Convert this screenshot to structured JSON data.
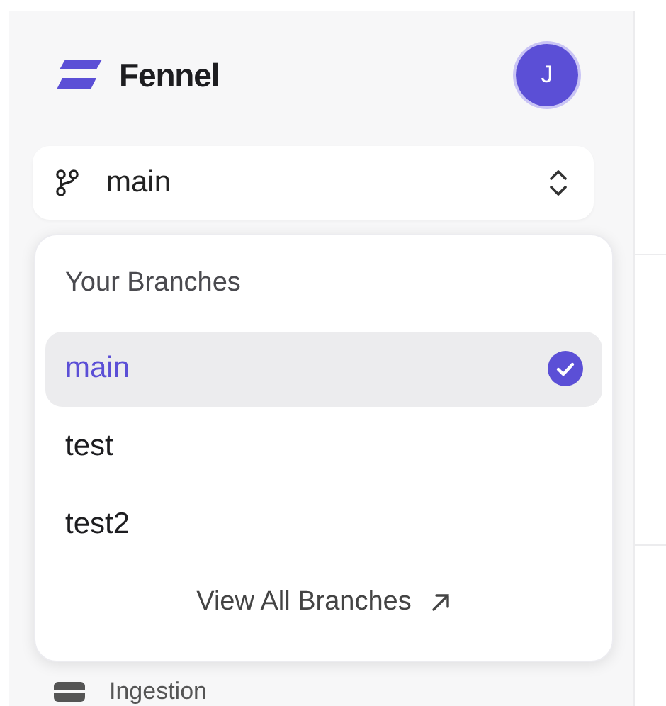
{
  "brand": {
    "name": "Fennel"
  },
  "user": {
    "initial": "J"
  },
  "branch_selector": {
    "value": "main",
    "expanded": true
  },
  "dropdown": {
    "heading": "Your Branches",
    "branches": [
      {
        "name": "main",
        "selected": true
      },
      {
        "name": "test",
        "selected": false
      },
      {
        "name": "test2",
        "selected": false
      }
    ],
    "footer_link": "View All Branches"
  },
  "nav_items": [
    {
      "label": "Ingestion"
    }
  ]
}
